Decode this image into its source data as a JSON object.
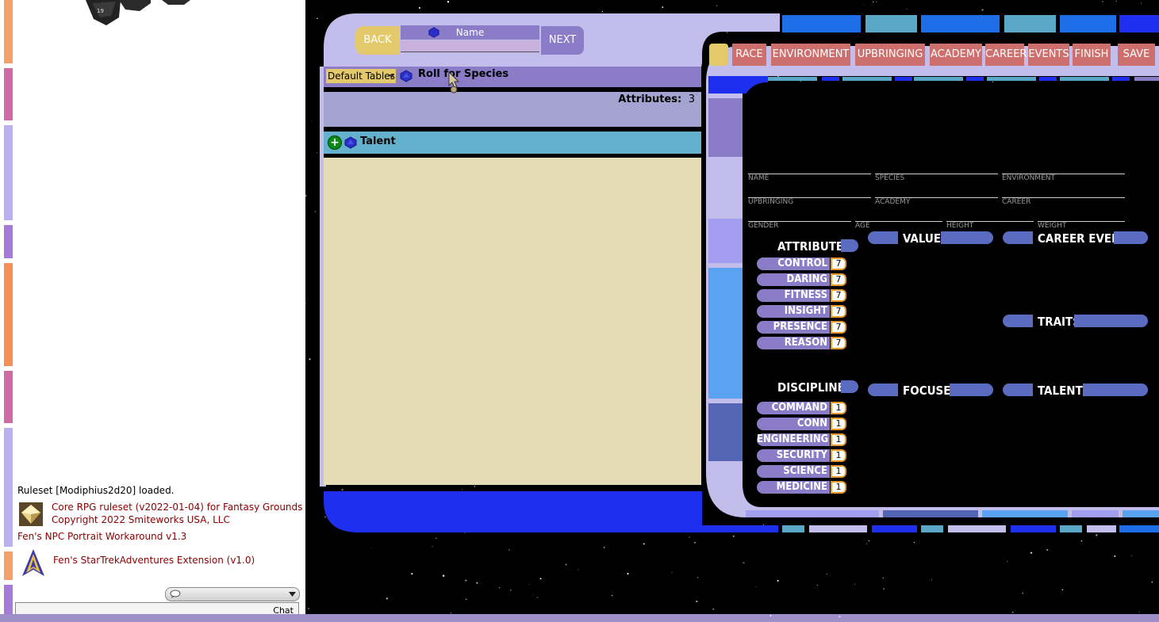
{
  "chat": {
    "messages": [
      {
        "text": "Ruleset [Modiphius2d20] loaded.",
        "style": "plain",
        "icon": ""
      },
      {
        "text": "Core RPG ruleset (v2022-01-04) for Fantasy Grounds",
        "style": "red",
        "icon": "core-rpg-logo-icon"
      },
      {
        "text": "Copyright 2022 Smiteworks USA, LLC",
        "style": "red",
        "icon": ""
      },
      {
        "text": "Fen's NPC Portrait Workaround v1.3",
        "style": "red",
        "icon": ""
      },
      {
        "text": "Fen's StarTrekAdventures Extension (v1.0)",
        "style": "red",
        "icon": "starfleet-delta-icon"
      }
    ],
    "send_label": "Chat"
  },
  "wizard": {
    "back_label": "BACK",
    "next_label": "NEXT",
    "name_label": "Name",
    "name_value": "",
    "default_tables": "Default Tables",
    "roll_label": "Roll for Species",
    "attributes_label": "Attributes:",
    "attributes_value": "3",
    "talent_label": "Talent"
  },
  "tabs": [
    "RACE",
    "ENVIRONMENT",
    "UPBRINGING",
    "ACADEMY",
    "CAREER",
    "EVENTS",
    "FINISH",
    "SAVE"
  ],
  "sheet": {
    "fields": [
      "NAME",
      "SPECIES",
      "ENVIRONMENT",
      "UPBRINGING",
      "ACADEMY",
      "CAREER",
      "GENDER",
      "AGE",
      "HEIGHT",
      "WEIGHT"
    ],
    "attributes_title": "ATTRIBUTES",
    "attributes": [
      {
        "name": "CONTROL",
        "value": "7"
      },
      {
        "name": "DARING",
        "value": "7"
      },
      {
        "name": "FITNESS",
        "value": "7"
      },
      {
        "name": "INSIGHT",
        "value": "7"
      },
      {
        "name": "PRESENCE",
        "value": "7"
      },
      {
        "name": "REASON",
        "value": "7"
      }
    ],
    "disciplines_title": "DISCIPLINES",
    "disciplines": [
      {
        "name": "COMMAND",
        "value": "1"
      },
      {
        "name": "CONN",
        "value": "1"
      },
      {
        "name": "ENGINEERING",
        "value": "1"
      },
      {
        "name": "SECURITY",
        "value": "1"
      },
      {
        "name": "SCIENCE",
        "value": "1"
      },
      {
        "name": "MEDICINE",
        "value": "1"
      }
    ],
    "values_title": "VALUES",
    "career_events_title": "CAREER EVENTS",
    "traits_title": "TRAITS",
    "focuses_title": "FOCUSES",
    "talents_title": "TALENTS"
  },
  "colors": {
    "lcars_lavender": "#c3bdec",
    "lcars_purple": "#8a7cc6",
    "lcars_blue": "#1e2af2",
    "lcars_sky": "#5aa3f3",
    "lcars_teal": "#63b1cc",
    "lcars_gold": "#e3c96a",
    "lcars_rose": "#cd6f6c",
    "parchment": "#e5dcb6"
  }
}
